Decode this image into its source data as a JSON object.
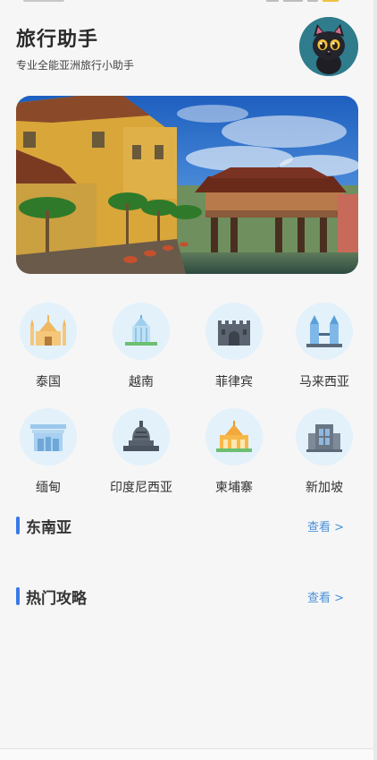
{
  "header": {
    "title": "旅行助手",
    "subtitle": "专业全能亚洲旅行小助手"
  },
  "destinations": [
    {
      "label": "泰国",
      "icon": "thai-temple-icon"
    },
    {
      "label": "越南",
      "icon": "vietnam-monument-icon"
    },
    {
      "label": "菲律宾",
      "icon": "philippines-fort-icon"
    },
    {
      "label": "马来西亚",
      "icon": "petronas-towers-icon"
    },
    {
      "label": "缅甸",
      "icon": "myanmar-gate-icon"
    },
    {
      "label": "印度尼西亚",
      "icon": "borobudur-stupa-icon"
    },
    {
      "label": "柬埔寨",
      "icon": "cambodia-palace-icon"
    },
    {
      "label": "新加坡",
      "icon": "singapore-building-icon"
    }
  ],
  "sections": {
    "southeast_asia": {
      "title": "东南亚",
      "more": "查看 >"
    },
    "hot_guides": {
      "title": "热门攻略",
      "more": "查看 >"
    }
  },
  "colors": {
    "accent": "#3a79e8",
    "link": "#4a90d9",
    "icon_bg": "#e3f1fb"
  }
}
